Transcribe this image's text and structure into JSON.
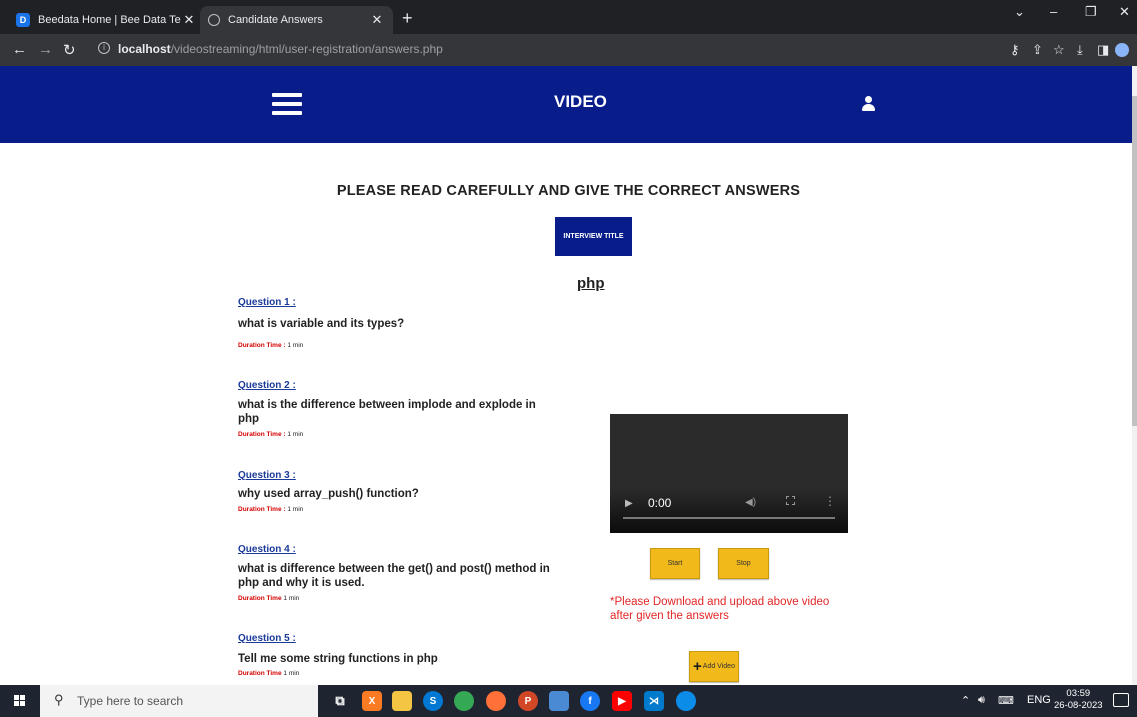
{
  "browser": {
    "tabs": [
      {
        "title": "Beedata Home | Bee Data Techno",
        "active": false,
        "favicon": "beedata-logo-icon"
      },
      {
        "title": "Candidate Answers",
        "active": true,
        "favicon": "globe-icon"
      }
    ],
    "url_host": "localhost",
    "url_path": "/videostreaming/html/user-registration/answers.php"
  },
  "header": {
    "title": "VIDEO",
    "background": "#081c8a"
  },
  "page": {
    "heading": "PLEASE READ CAREFULLY AND GIVE THE CORRECT ANSWERS",
    "interview_button": "INTERVIEW TITLE",
    "interview_name": "php"
  },
  "questions": [
    {
      "label": "Question 1 :",
      "text": "what is variable and its types?",
      "duration_label": "Duration Time :",
      "duration": "1 min"
    },
    {
      "label": "Question 2 :",
      "text": "what is the difference between implode and explode in php",
      "duration_label": "Duration Time :",
      "duration": "1 min"
    },
    {
      "label": "Question 3 :",
      "text": "why used array_push() function?",
      "duration_label": "Duration Time :",
      "duration": "1 min"
    },
    {
      "label": "Question 4 :",
      "text": "what is difference between the get() and post() method in php and why it is used.",
      "duration_label": "Duration Time",
      "duration": "1 min"
    },
    {
      "label": "Question 5 :",
      "text": "Tell me some string functions in php",
      "duration_label": "Duration Time",
      "duration": "1 min"
    }
  ],
  "video": {
    "time": "0:00",
    "start_label": "Start",
    "stop_label": "Stop",
    "notice": "*Please Download and upload above video after given the answers",
    "add_video_label": "Add Video",
    "button_color": "#f2b91b",
    "notice_color": "#e32626"
  },
  "taskbar": {
    "search_placeholder": "Type here to search",
    "language": "ENG",
    "time": "03:59",
    "date": "26-08-2023"
  }
}
